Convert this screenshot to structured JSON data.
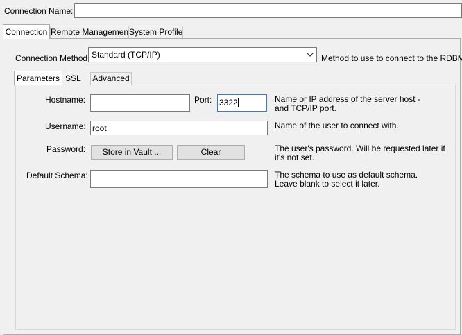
{
  "connection_name": {
    "label": "Connection Name:",
    "value": ""
  },
  "main_tabs": [
    {
      "label": "Connection",
      "active": true
    },
    {
      "label": "Remote Management",
      "active": false
    },
    {
      "label": "System Profile",
      "active": false
    }
  ],
  "connection_method": {
    "label": "Connection Method:",
    "value": "Standard (TCP/IP)",
    "help": "Method to use to connect to the RDBMS",
    "dropdown_icon": "chevron-down-icon"
  },
  "sub_tabs": [
    {
      "label": "Parameters",
      "active": true
    },
    {
      "label": "SSL",
      "active": false
    },
    {
      "label": "Advanced",
      "active": false
    }
  ],
  "parameters": {
    "hostname": {
      "label": "Hostname:",
      "value": ""
    },
    "port": {
      "label": "Port:",
      "value": "3322"
    },
    "hostname_help": "Name or IP address of the server host - and TCP/IP port.",
    "username": {
      "label": "Username:",
      "value": "root",
      "help": "Name of the user to connect with."
    },
    "password": {
      "label": "Password:",
      "store_button": "Store in Vault ...",
      "clear_button": "Clear",
      "help": "The user's password. Will be requested later if it's not set."
    },
    "default_schema": {
      "label": "Default Schema:",
      "value": "",
      "help": "The schema to use as default schema. Leave blank to select it later."
    }
  },
  "colors": {
    "panel": "#f0f0f0",
    "input_border": "#7a7a7a",
    "focus_border": "#3c78c8",
    "button_face": "#e1e1e1"
  }
}
